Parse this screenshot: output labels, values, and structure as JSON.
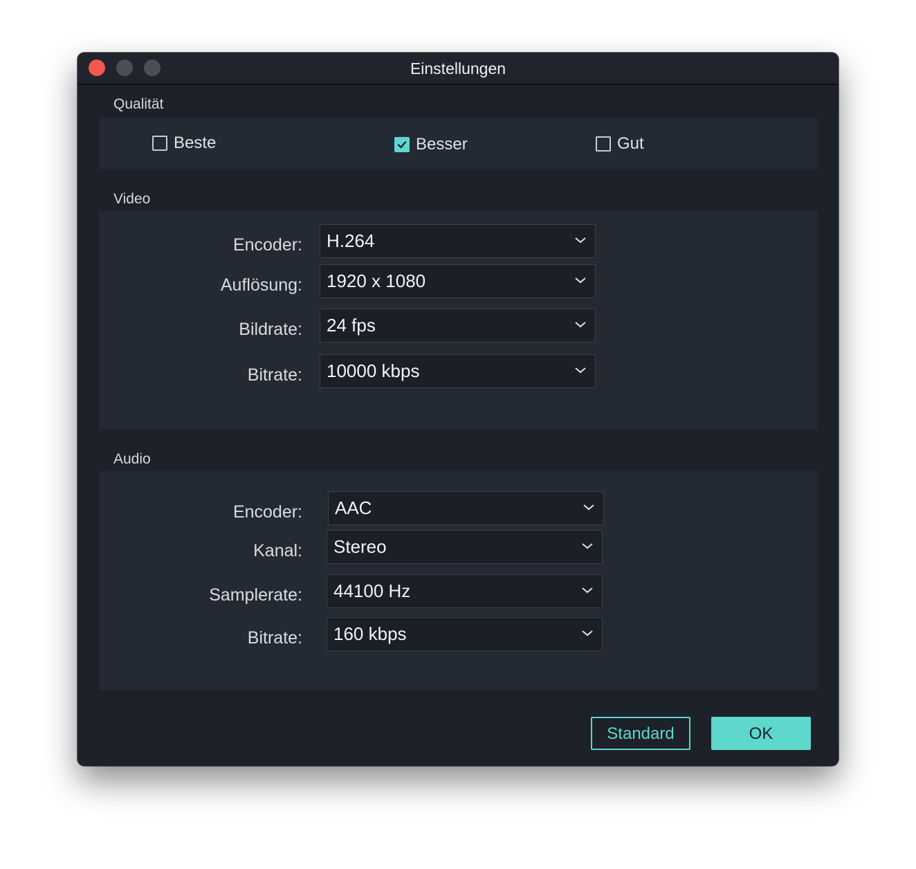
{
  "window": {
    "title": "Einstellungen"
  },
  "quality": {
    "label": "Qualität",
    "options": [
      {
        "label": "Beste",
        "checked": false
      },
      {
        "label": "Besser",
        "checked": true
      },
      {
        "label": "Gut",
        "checked": false
      }
    ]
  },
  "video": {
    "label": "Video",
    "encoder": {
      "label": "Encoder:",
      "value": "H.264"
    },
    "resolution": {
      "label": "Auflösung:",
      "value": "1920 x 1080"
    },
    "framerate": {
      "label": "Bildrate:",
      "value": "24 fps"
    },
    "bitrate": {
      "label": "Bitrate:",
      "value": "10000 kbps"
    }
  },
  "audio": {
    "label": "Audio",
    "encoder": {
      "label": "Encoder:",
      "value": "AAC"
    },
    "channel": {
      "label": "Kanal:",
      "value": "Stereo"
    },
    "samplerate": {
      "label": "Samplerate:",
      "value": "44100 Hz"
    },
    "bitrate": {
      "label": "Bitrate:",
      "value": "160 kbps"
    }
  },
  "buttons": {
    "standard": "Standard",
    "ok": "OK"
  },
  "colors": {
    "accent": "#5ed7cd",
    "window_bg": "#1d2129",
    "panel_bg": "#242a34",
    "close": "#f4574d"
  }
}
